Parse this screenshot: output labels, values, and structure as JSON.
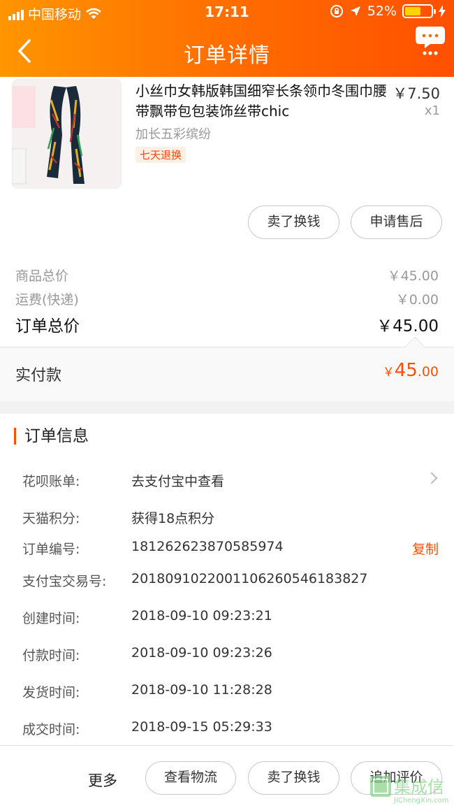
{
  "status_bar": {
    "carrier": "中国移动",
    "time": "17:11",
    "battery": "52%"
  },
  "nav": {
    "title": "订单详情"
  },
  "product": {
    "title": "小丝巾女韩版韩国细窄长条领巾冬围巾腰带飘带包包装饰丝带chic",
    "price": "￥7.50",
    "quantity": "x1",
    "sku": "加长五彩缤纷",
    "tag": "七天退换",
    "buttons": {
      "sell": "卖了换钱",
      "after_sale": "申请售后"
    }
  },
  "summary": {
    "goods_label": "商品总价",
    "goods_value": "￥45.00",
    "shipping_label": "运费(快递)",
    "shipping_value": "￥0.00",
    "total_label": "订单总价",
    "total_value": "￥45.00",
    "paid_label": "实付款",
    "paid_currency": "￥",
    "paid_int": "45",
    "paid_dec": ".00"
  },
  "order_info": {
    "title": "订单信息",
    "huabei_label": "花呗账单:",
    "huabei_value": "去支付宝中查看",
    "points_label": "天猫积分:",
    "points_value": "获得18点积分",
    "order_no_label": "订单编号:",
    "order_no_value": "181262623870585974",
    "copy_label": "复制",
    "alipay_label": "支付宝交易号:",
    "alipay_value": "2018091022001106260546183827",
    "created_label": "创建时间:",
    "created_value": "2018-09-10 09:23:21",
    "paid_time_label": "付款时间:",
    "paid_time_value": "2018-09-10 09:23:26",
    "shipped_label": "发货时间:",
    "shipped_value": "2018-09-10 11:28:28",
    "done_label": "成交时间:",
    "done_value": "2018-09-15 05:29:33"
  },
  "bottom": {
    "more": "更多",
    "logistics": "查看物流",
    "sell": "卖了换钱",
    "review": "追加评价"
  },
  "watermark": {
    "text": "JiChengXin.com",
    "chars": "集成信"
  },
  "colors": {
    "accent": "#ff5000",
    "header_start": "#ff9500",
    "header_end": "#ff5000"
  }
}
